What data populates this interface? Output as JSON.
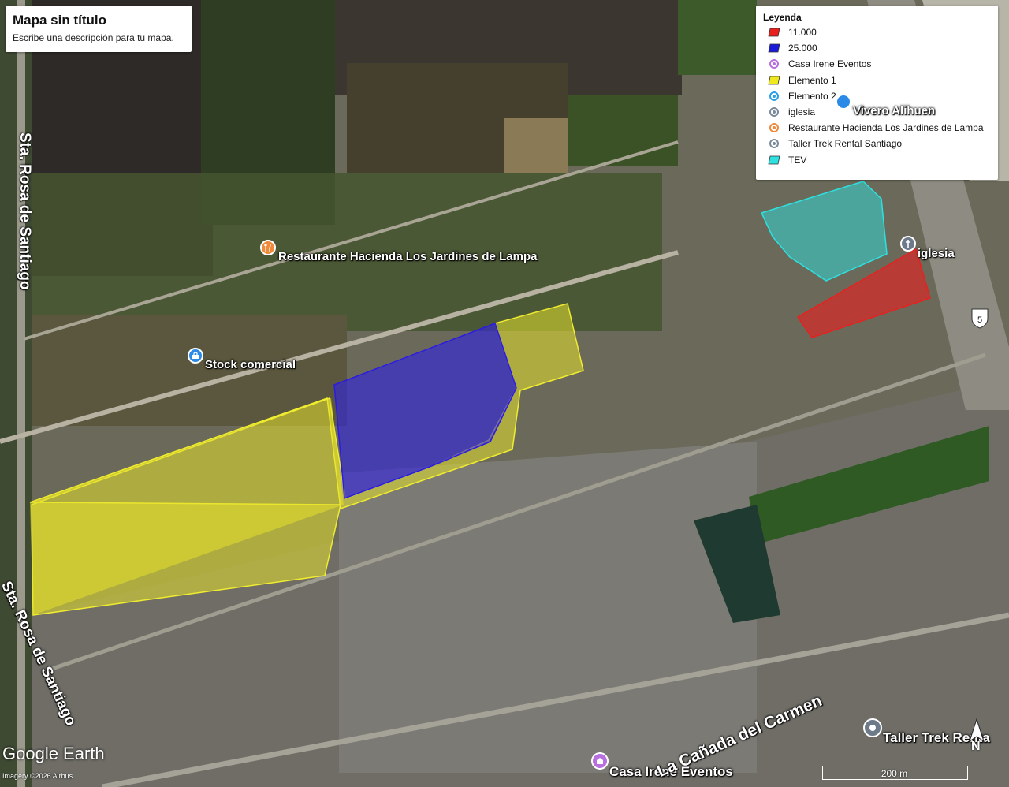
{
  "map": {
    "title": "Mapa sin título",
    "description": "Escribe una descripción para tu mapa."
  },
  "legend": {
    "title": "Leyenda",
    "items": [
      {
        "label": "11.000",
        "kind": "polygon",
        "color": "#e8201e",
        "icon": "polygon-icon"
      },
      {
        "label": "25.000",
        "kind": "polygon",
        "color": "#1a1ad8",
        "icon": "polygon-icon"
      },
      {
        "label": "Casa Irene Eventos",
        "kind": "pin",
        "color": "#b86fe0",
        "icon": "pin-icon"
      },
      {
        "label": "Elemento 1",
        "kind": "polygon",
        "color": "#f0e81e",
        "icon": "polygon-icon"
      },
      {
        "label": "Elemento 2",
        "kind": "pin",
        "color": "#2a9fe6",
        "icon": "pin-icon"
      },
      {
        "label": "iglesia",
        "kind": "pin",
        "color": "#7a8a9a",
        "icon": "pin-icon"
      },
      {
        "label": "Restaurante Hacienda Los Jardines de Lampa",
        "kind": "pin",
        "color": "#f08a3a",
        "icon": "pin-icon"
      },
      {
        "label": "Taller Trek Rental Santiago",
        "kind": "pin",
        "color": "#7a8a9a",
        "icon": "pin-icon"
      },
      {
        "label": "TEV",
        "kind": "polygon",
        "color": "#2ee0e0",
        "icon": "polygon-icon"
      }
    ]
  },
  "places": {
    "restaurante": "Restaurante Hacienda Los Jardines de Lampa",
    "stock": "Stock comercial",
    "vivero": "Vivero Alihuen",
    "iglesia": "iglesia",
    "taller": "Taller Trek Renta",
    "casa_irene": "Casa Irene Eventos"
  },
  "roads": {
    "santa_rosa_top": "Sta. Rosa de Santiago",
    "santa_rosa_bottom": "Sta. Rosa de Santiago",
    "canada": "La Cañada del Carmen",
    "highway_shield": "5"
  },
  "footer": {
    "logo": "Google Earth",
    "imagery": "Imagery ©2026 Airbus",
    "scale": "200 m",
    "north": "N"
  }
}
